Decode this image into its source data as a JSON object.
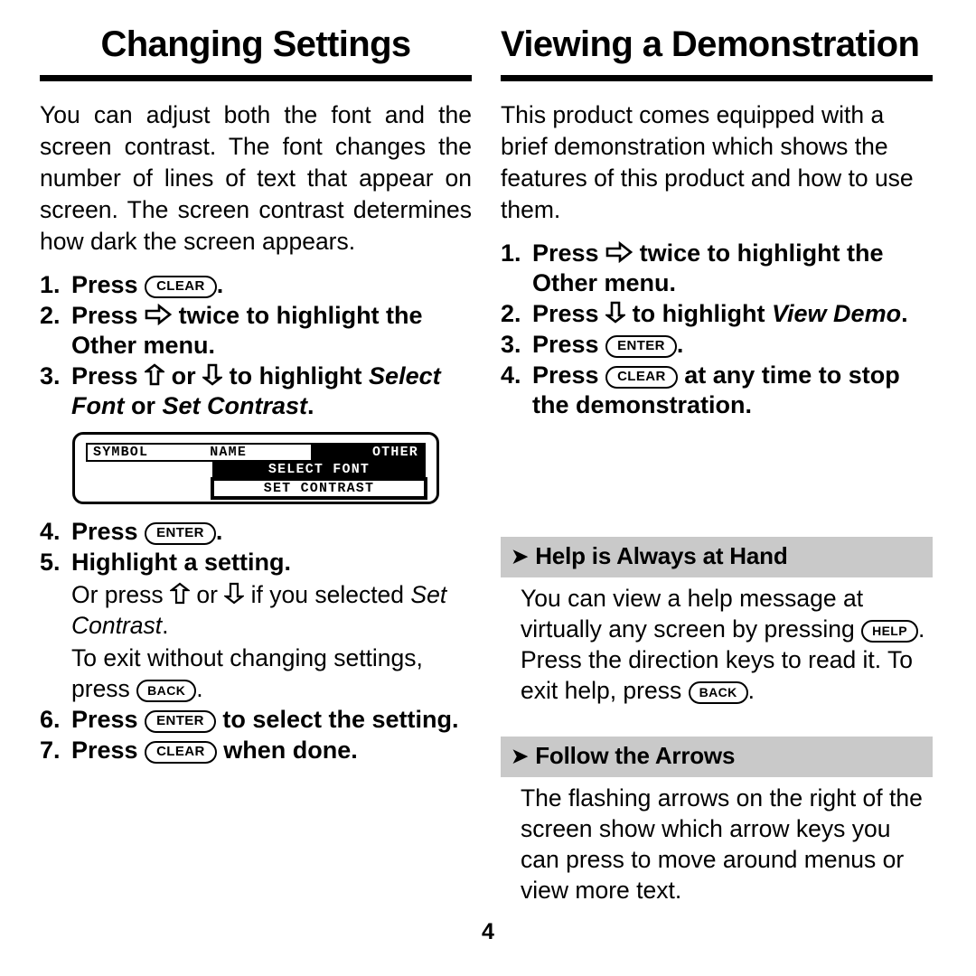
{
  "page": {
    "number": "4",
    "background": "#ffffff",
    "text_color": "#000000",
    "tip_header_bg": "#c9c9c9"
  },
  "left_column": {
    "heading": "Changing Settings",
    "intro": "You can adjust both the font and the screen contrast. The font changes the number of lines of text that appear on screen. The screen contrast determines how dark the screen appears.",
    "steps": [
      {
        "parts": [
          {
            "type": "text",
            "value": "Press "
          },
          {
            "type": "key",
            "value": "CLEAR"
          },
          {
            "type": "text",
            "value": "."
          }
        ]
      },
      {
        "parts": [
          {
            "type": "text",
            "value": "Press "
          },
          {
            "type": "icon",
            "value": "arrow-right-icon"
          },
          {
            "type": "text",
            "value": " twice to highlight the Other menu."
          }
        ]
      },
      {
        "parts": [
          {
            "type": "text",
            "value": "Press "
          },
          {
            "type": "icon",
            "value": "arrow-up-icon"
          },
          {
            "type": "text",
            "value": " or "
          },
          {
            "type": "icon",
            "value": "arrow-down-icon"
          },
          {
            "type": "text",
            "value": " to highlight "
          },
          {
            "type": "bold-italic",
            "value": "Select Font"
          },
          {
            "type": "text",
            "value": " or "
          },
          {
            "type": "bold-italic",
            "value": "Set Contrast"
          },
          {
            "type": "text",
            "value": "."
          }
        ]
      },
      {
        "parts": [
          {
            "type": "text",
            "value": "Press "
          },
          {
            "type": "key",
            "value": "ENTER"
          },
          {
            "type": "text",
            "value": "."
          }
        ]
      },
      {
        "parts": [
          {
            "type": "text",
            "value": "Highlight a setting."
          }
        ],
        "sub_lines": [
          "Or press ⇧ or ⇩ if you selected Set Contrast.",
          "To exit without changing settings, press BACK."
        ]
      },
      {
        "parts": [
          {
            "type": "text",
            "value": "Press "
          },
          {
            "type": "key",
            "value": "ENTER"
          },
          {
            "type": "text",
            "value": " to select the setting."
          }
        ]
      },
      {
        "parts": [
          {
            "type": "text",
            "value": "Press "
          },
          {
            "type": "key",
            "value": "CLEAR"
          },
          {
            "type": "text",
            "value": " when done."
          }
        ]
      }
    ],
    "step5_sub": {
      "line1_pre": "Or press ",
      "line1_mid": " or ",
      "line1_post": " if you selected ",
      "line1_italic": "Set Contrast",
      "line1_end": ".",
      "line2": "To exit without changing settings, press ",
      "line2_key": "BACK",
      "line2_end": "."
    },
    "lcd": {
      "menu_tabs": [
        "SYMBOL",
        "NAME",
        "OTHER"
      ],
      "selected_tab": "OTHER",
      "dropdown_items": [
        "SELECT FONT",
        "SET CONTRAST"
      ],
      "highlighted_item": "SET CONTRAST"
    }
  },
  "right_column": {
    "heading": "Viewing a Demonstration",
    "intro": "This product comes equipped with a brief demonstration which shows the features of this product and how to use them.",
    "steps": [
      {
        "pre": "Press ",
        "icon": "arrow-right-icon",
        "post": " twice to highlight the Other menu."
      },
      {
        "pre": "Press ",
        "icon": "arrow-down-icon",
        "post": " to highlight ",
        "italic": "View Demo",
        "end": "."
      },
      {
        "pre": "Press ",
        "key": "ENTER",
        "post": "."
      },
      {
        "pre": "Press ",
        "key": "CLEAR",
        "post": " at any time to stop the demonstration."
      }
    ],
    "tips": [
      {
        "bullet": "➤",
        "title": "Help is Always at Hand",
        "body_pre": "You can view a help message at virtually any screen by pressing ",
        "key1": "HELP",
        "body_mid": ".  Press the direction keys to read it. To exit help, press ",
        "key2": "BACK",
        "body_end": "."
      },
      {
        "bullet": "➤",
        "title": "Follow the Arrows",
        "body_plain": "The flashing arrows on the right of the screen show which arrow keys you can press to move around menus or view more text."
      }
    ]
  }
}
